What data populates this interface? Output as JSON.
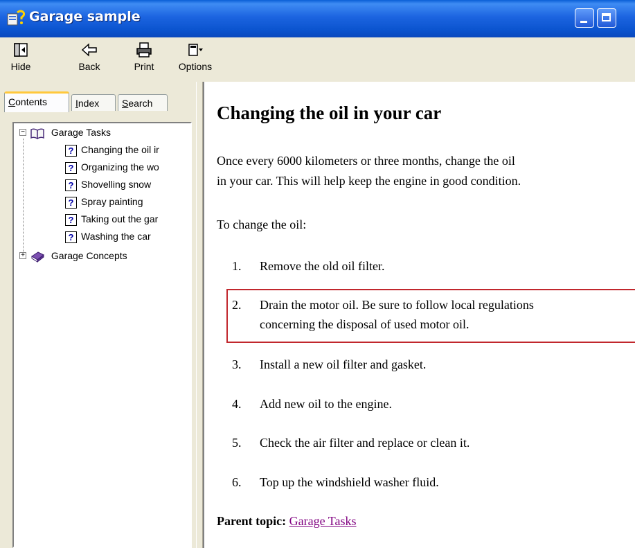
{
  "window": {
    "title": "Garage sample"
  },
  "toolbar": {
    "hide_label": "Hide",
    "back_label": "Back",
    "print_label": "Print",
    "options_label": "Options"
  },
  "tabs": {
    "contents": "Contents",
    "index": "Index",
    "search": "Search"
  },
  "tree": {
    "root1": "Garage Tasks",
    "children": [
      "Changing the oil ir",
      "Organizing the wo",
      "Shovelling snow",
      "Spray painting",
      "Taking out the gar",
      "Washing the car"
    ],
    "root2": "Garage Concepts",
    "child_icon": "?"
  },
  "topic": {
    "title": "Changing the oil in your car",
    "intro_line1": "Once every 6000 kilometers or three months, change the oil",
    "intro_line2": "in your car. This will help keep the engine in good condition.",
    "lead": "To change the oil:",
    "steps": [
      {
        "num": "1.",
        "line1": "Remove the old oil filter.",
        "line2": ""
      },
      {
        "num": "2.",
        "line1": "Drain the motor oil. Be sure to follow local regulations",
        "line2": "concerning the disposal of used motor oil."
      },
      {
        "num": "3.",
        "line1": "Install a new oil filter and gasket.",
        "line2": ""
      },
      {
        "num": "4.",
        "line1": "Add new oil to the engine.",
        "line2": ""
      },
      {
        "num": "5.",
        "line1": "Check the air filter and replace or clean it.",
        "line2": ""
      },
      {
        "num": "6.",
        "line1": "Top up the windshield washer fluid.",
        "line2": ""
      }
    ],
    "parent_label": "Parent topic:",
    "parent_link": "Garage Tasks"
  },
  "colors": {
    "titlebar": "#0a54cf",
    "highlight_border": "#c1272d",
    "visited_link": "#800080",
    "help_icon_blue": "#0000a8"
  }
}
